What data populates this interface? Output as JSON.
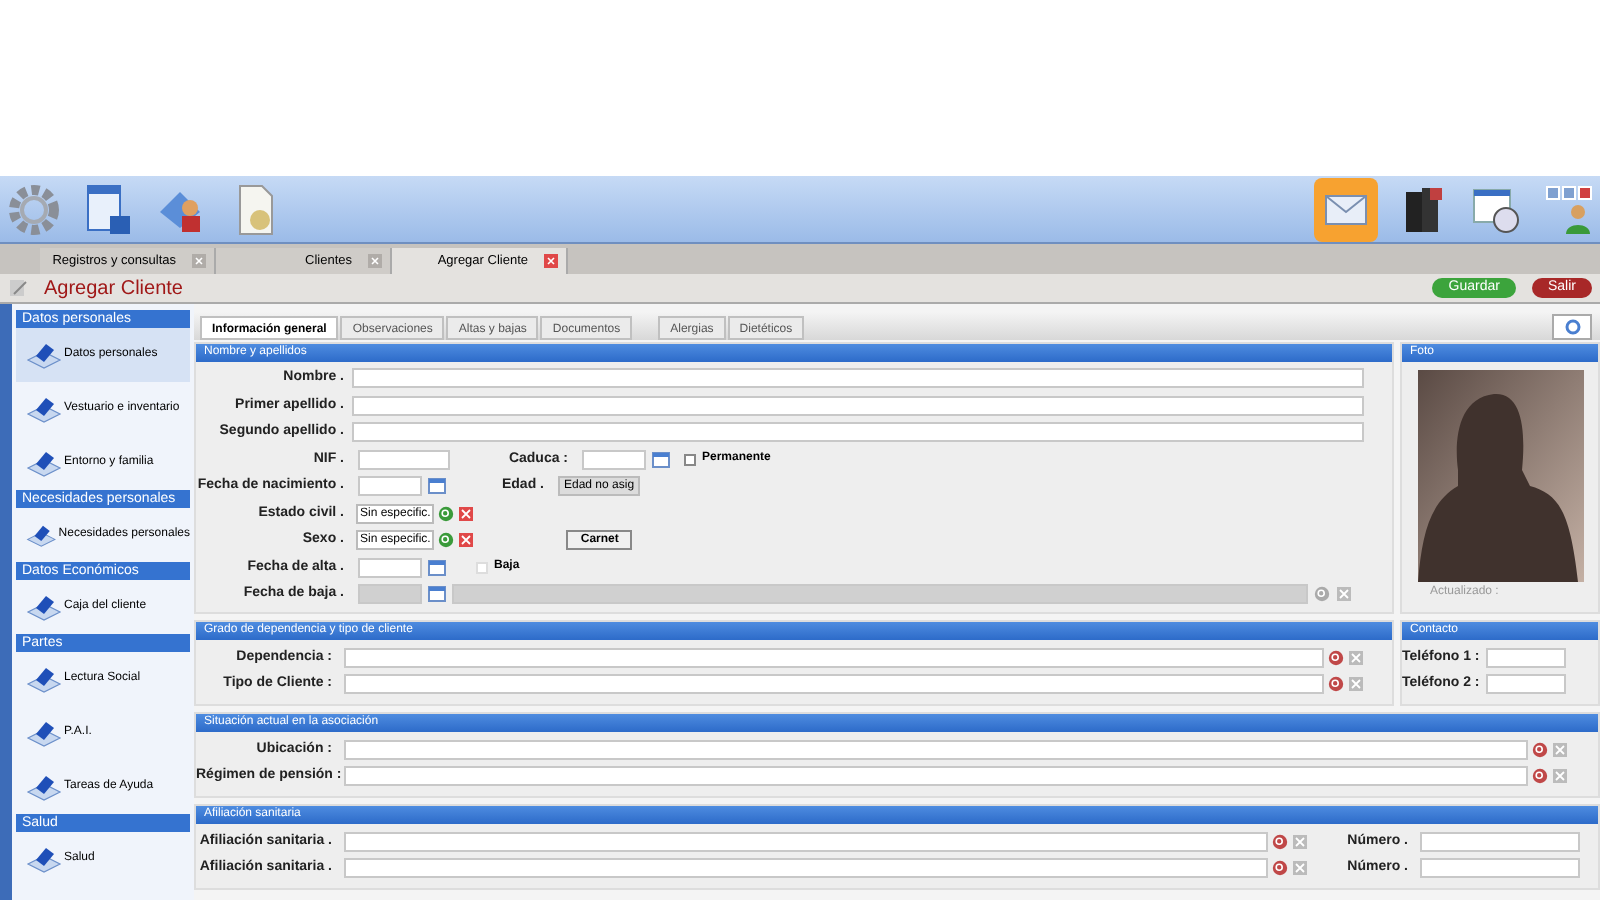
{
  "doc_tabs": [
    {
      "label": "Registros y consultas",
      "selected": false
    },
    {
      "label": "Clientes",
      "selected": false
    },
    {
      "label": "Agregar Cliente",
      "selected": true
    }
  ],
  "page_title": "Agregar Cliente",
  "actions": [
    {
      "label": "Guardar",
      "kind": "save"
    },
    {
      "label": "Salir",
      "kind": "exit"
    }
  ],
  "sidebar": [
    {
      "header": "Datos personales",
      "items": [
        {
          "label": "Datos personales",
          "selected": true
        },
        {
          "label": "Vestuario e inventario",
          "selected": false
        },
        {
          "label": "Entorno y familia",
          "selected": false
        }
      ]
    },
    {
      "header": "Necesidades personales",
      "items": [
        {
          "label": "Necesidades personales",
          "selected": false
        }
      ]
    },
    {
      "header": "Datos Económicos",
      "items": [
        {
          "label": "Caja del cliente",
          "selected": false
        }
      ]
    },
    {
      "header": "Partes",
      "items": [
        {
          "label": "Lectura Social",
          "selected": false
        },
        {
          "label": "P.A.I.",
          "selected": false
        },
        {
          "label": "Tareas de Ayuda",
          "selected": false
        }
      ]
    },
    {
      "header": "Salud",
      "items": [
        {
          "label": "Salud",
          "selected": false
        }
      ]
    }
  ],
  "tabs": [
    {
      "label": "Información general",
      "selected": true
    },
    {
      "label": "Observaciones",
      "selected": false
    },
    {
      "label": "Altas y bajas",
      "selected": false
    },
    {
      "label": "Documentos",
      "selected": false
    },
    {
      "label": "Alergias",
      "selected": false
    },
    {
      "label": "Dietéticos",
      "selected": false
    }
  ],
  "name_section": {
    "title": "Nombre y apellidos",
    "fields": [
      "Nombre .",
      "Primer apellido .",
      "Segundo apellido ."
    ],
    "nif": "NIF .",
    "caduca": "Caduca :",
    "permanente": {
      "label": "Permanente",
      "checked": false
    },
    "birth": "Fecha de nacimiento .",
    "edad": "Edad .",
    "edad_value": "Edad no asig",
    "estado": "Estado civil .",
    "estado_value": "Sin especific.",
    "sexo": "Sexo .",
    "sexo_value": "Sin especific.",
    "carnet": "Carnet",
    "alta": "Fecha de alta .",
    "baja": {
      "label": "Baja",
      "checked": false
    },
    "fecha_baja": "Fecha de baja ."
  },
  "photo": {
    "title": "Foto",
    "caption": "Actualizado :"
  },
  "dependency": {
    "title": "Grado de dependencia y tipo de cliente",
    "fields": [
      "Dependencia :",
      "Tipo de Cliente :"
    ]
  },
  "contact": {
    "title": "Contacto",
    "fields": [
      "Teléfono 1 :",
      "Teléfono 2 :"
    ]
  },
  "situation": {
    "title": "Situación actual en la asociación",
    "fields": [
      "Ubicación :",
      "Régimen de pensión :"
    ]
  },
  "insurance": {
    "title": "Afiliación sanitaria",
    "rows": [
      {
        "label": "Afiliación sanitaria .",
        "number": "Número ."
      },
      {
        "label": "Afiliación sanitaria .",
        "number": "Número ."
      }
    ]
  }
}
